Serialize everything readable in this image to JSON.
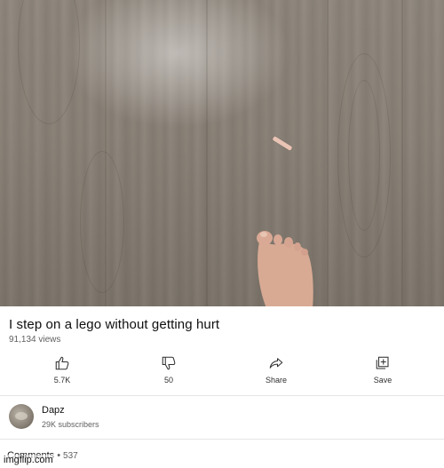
{
  "video": {
    "title": "I step on a lego without getting hurt",
    "views": "91,134 views"
  },
  "actions": [
    {
      "id": "like",
      "label": "5.7K",
      "icon": "thumbs-up-icon"
    },
    {
      "id": "dislike",
      "label": "50",
      "icon": "thumbs-down-icon"
    },
    {
      "id": "share",
      "label": "Share",
      "icon": "share-icon"
    },
    {
      "id": "save",
      "label": "Save",
      "icon": "add-to-playlist-icon"
    }
  ],
  "channel": {
    "name": "Dapz",
    "subscribers": "29K subscribers"
  },
  "comments": {
    "label": "Comments",
    "separator": "•",
    "count": "537"
  },
  "watermark": "imgflip.com"
}
